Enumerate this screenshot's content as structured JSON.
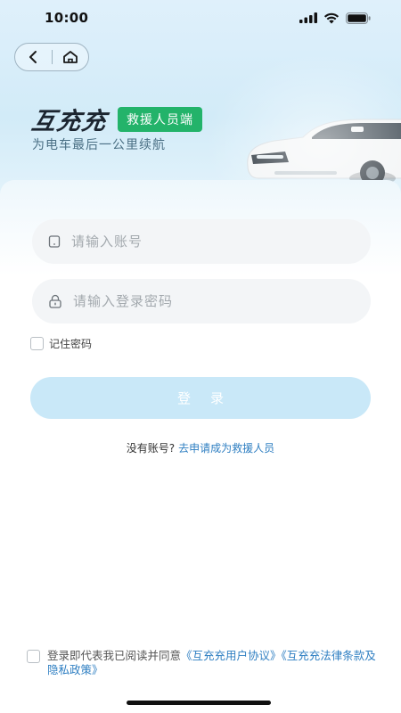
{
  "status_bar": {
    "time": "10:00"
  },
  "brand": {
    "name": "互充充",
    "badge": "救援人员端",
    "slogan": "为电车最后一公里续航"
  },
  "form": {
    "account_placeholder": "请输入账号",
    "password_placeholder": "请输入登录密码",
    "remember_label": "记住密码",
    "login_label": "登录"
  },
  "register": {
    "prompt": "没有账号?",
    "link": "去申请成为救援人员"
  },
  "agreement": {
    "prefix": "登录即代表我已阅读并同意",
    "user_agreement": "《互充充用户协议》",
    "privacy_policy": "《互充充法律条款及隐私政策》"
  },
  "colors": {
    "brand_green": "#23b36a",
    "link_blue": "#2f7fc2",
    "button_disabled": "#c9e8f8"
  }
}
